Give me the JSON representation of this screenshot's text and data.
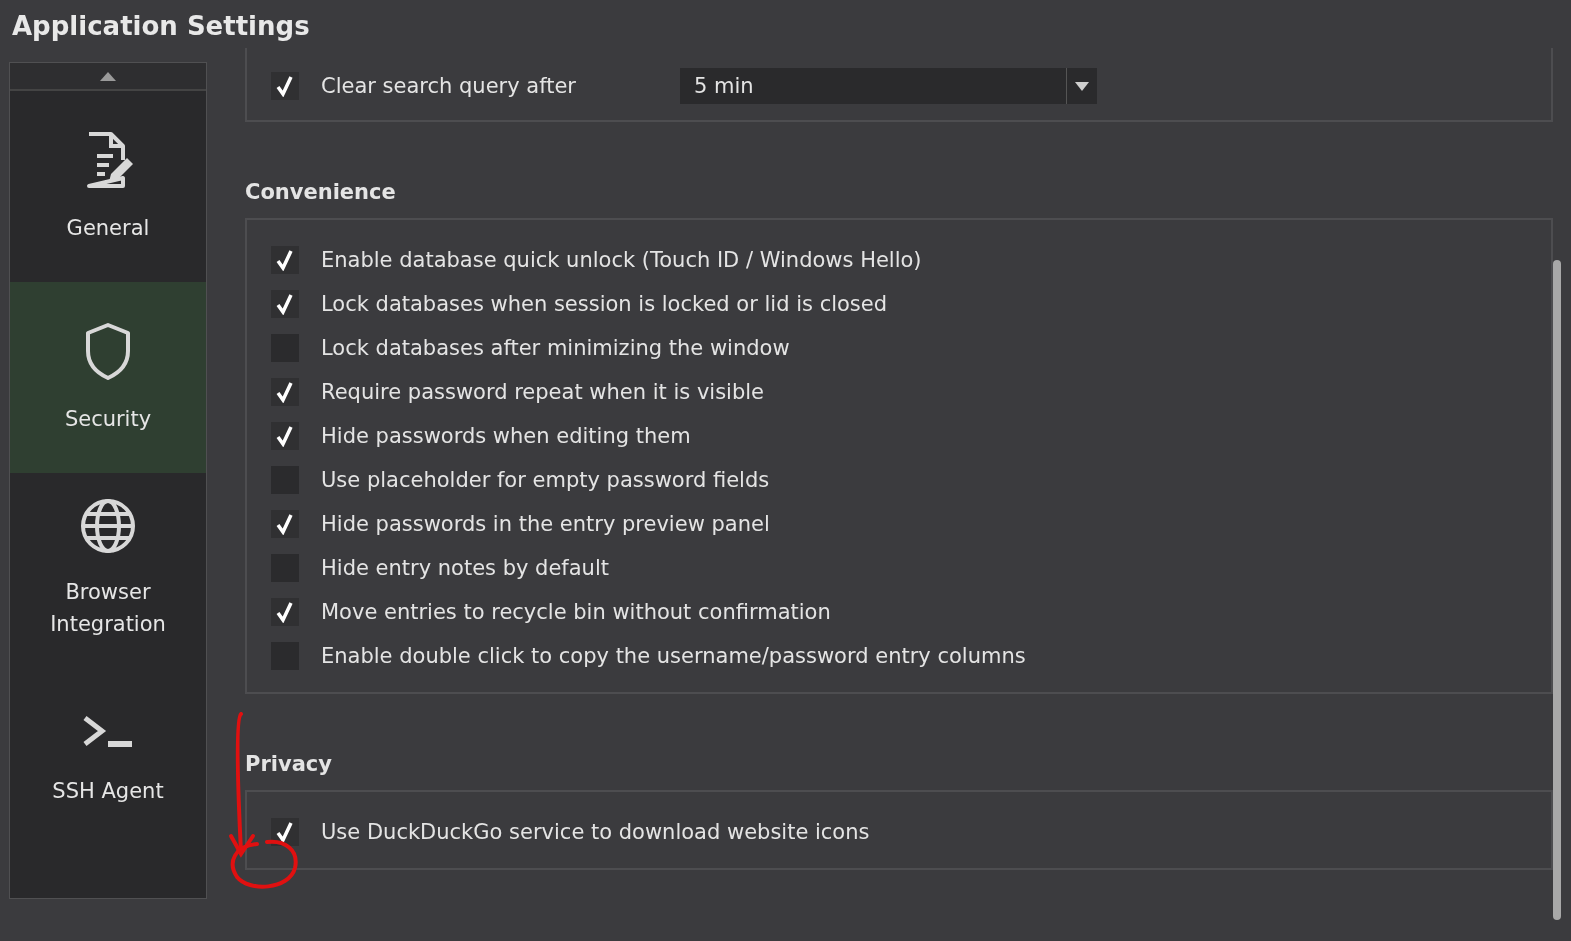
{
  "window": {
    "title": "Application Settings"
  },
  "sidebar": {
    "items": [
      {
        "label": "General",
        "kind": "general",
        "selected": false
      },
      {
        "label": "Security",
        "kind": "security",
        "selected": true
      },
      {
        "label": "Browser Integration",
        "kind": "browser",
        "selected": false
      },
      {
        "label": "SSH Agent",
        "kind": "ssh",
        "selected": false
      }
    ]
  },
  "top_group": {
    "option": {
      "label": "Clear search query after",
      "checked": true
    },
    "dropdown": {
      "value": "5 min"
    }
  },
  "sections": [
    {
      "title": "Convenience",
      "options": [
        {
          "label": "Enable database quick unlock (Touch ID / Windows Hello)",
          "checked": true
        },
        {
          "label": "Lock databases when session is locked or lid is closed",
          "checked": true
        },
        {
          "label": "Lock databases after minimizing the window",
          "checked": false
        },
        {
          "label": "Require password repeat when it is visible",
          "checked": true
        },
        {
          "label": "Hide passwords when editing them",
          "checked": true
        },
        {
          "label": "Use placeholder for empty password fields",
          "checked": false
        },
        {
          "label": "Hide passwords in the entry preview panel",
          "checked": true
        },
        {
          "label": "Hide entry notes by default",
          "checked": false
        },
        {
          "label": "Move entries to recycle bin without confirmation",
          "checked": true
        },
        {
          "label": "Enable double click to copy the username/password entry columns",
          "checked": false
        }
      ]
    },
    {
      "title": "Privacy",
      "options": [
        {
          "label": "Use DuckDuckGo service to download website icons",
          "checked": true
        }
      ]
    }
  ]
}
